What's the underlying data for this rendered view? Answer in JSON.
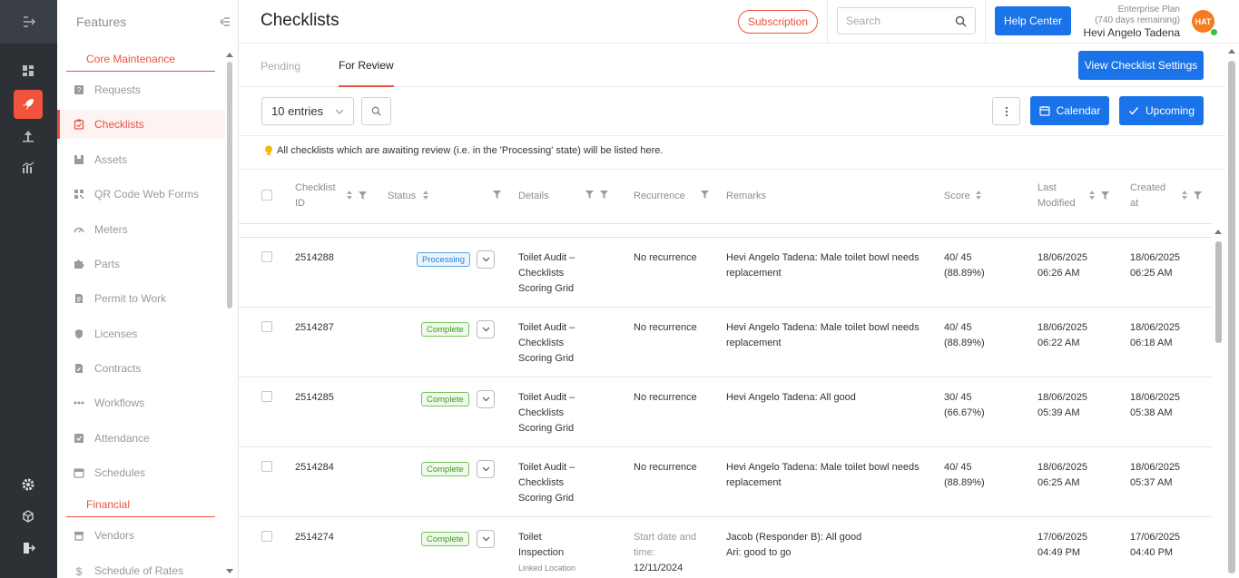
{
  "features": {
    "title": "Features",
    "sections": {
      "core": "Core Maintenance",
      "financial": "Financial"
    },
    "items": [
      {
        "label": "Requests",
        "icon": "question-square-icon"
      },
      {
        "label": "Checklists",
        "icon": "checklist-icon"
      },
      {
        "label": "Assets",
        "icon": "box-icon"
      },
      {
        "label": "QR Code Web Forms",
        "icon": "qr-code-icon"
      },
      {
        "label": "Meters",
        "icon": "gauge-icon"
      },
      {
        "label": "Parts",
        "icon": "puzzle-icon"
      },
      {
        "label": "Permit to Work",
        "icon": "document-icon"
      },
      {
        "label": "Licenses",
        "icon": "shield-icon"
      },
      {
        "label": "Contracts",
        "icon": "contract-icon"
      },
      {
        "label": "Workflows",
        "icon": "workflow-icon"
      },
      {
        "label": "Attendance",
        "icon": "attendance-icon"
      },
      {
        "label": "Schedules",
        "icon": "calendar-icon"
      }
    ],
    "financial_items": [
      {
        "label": "Vendors",
        "icon": "store-icon"
      },
      {
        "label": "Schedule of Rates",
        "icon": "dollar-icon"
      }
    ]
  },
  "header": {
    "title": "Checklists",
    "subscription": "Subscription",
    "search_placeholder": "Search",
    "help": "Help Center",
    "plan": "Enterprise Plan",
    "plan_remaining": "(740 days remaining)",
    "user_name": "Hevi Angelo Tadena",
    "avatar_initials": "HAT"
  },
  "tabs": {
    "pending": "Pending",
    "for_review": "For Review",
    "view_settings": "View Checklist Settings"
  },
  "toolbar": {
    "entries": "10 entries",
    "calendar": "Calendar",
    "upcoming": "Upcoming"
  },
  "info_text": "All checklists which are awaiting review (i.e. in the 'Processing' state) will be listed here.",
  "columns": {
    "checklist_id_1": "Checklist",
    "checklist_id_2": "ID",
    "status": "Status",
    "details": "Details",
    "recurrence": "Recurrence",
    "remarks": "Remarks",
    "score": "Score",
    "last_modified_1": "Last",
    "last_modified_2": "Modified",
    "created_at_1": "Created",
    "created_at_2": "at"
  },
  "rows": [
    {
      "id": "2514288",
      "status": "Processing",
      "details": [
        "Toilet Audit –",
        "Checklists",
        "Scoring Grid"
      ],
      "recurrence": "No recurrence",
      "remarks": [
        "Hevi Angelo Tadena: Male toilet bowl needs",
        "replacement"
      ],
      "score": [
        "40/ 45",
        "(88.89%)"
      ],
      "modified": [
        "18/06/2025",
        "06:26 AM"
      ],
      "created": [
        "18/06/2025",
        "06:25 AM"
      ]
    },
    {
      "id": "2514287",
      "status": "Complete",
      "details": [
        "Toilet Audit –",
        "Checklists",
        "Scoring Grid"
      ],
      "recurrence": "No recurrence",
      "remarks": [
        "Hevi Angelo Tadena: Male toilet bowl needs",
        "replacement"
      ],
      "score": [
        "40/ 45",
        "(88.89%)"
      ],
      "modified": [
        "18/06/2025",
        "06:22 AM"
      ],
      "created": [
        "18/06/2025",
        "06:18 AM"
      ]
    },
    {
      "id": "2514285",
      "status": "Complete",
      "details": [
        "Toilet Audit –",
        "Checklists",
        "Scoring Grid"
      ],
      "recurrence": "No recurrence",
      "remarks": [
        "Hevi Angelo Tadena: All good",
        ""
      ],
      "score": [
        "30/ 45",
        "(66.67%)"
      ],
      "modified": [
        "18/06/2025",
        "05:39 AM"
      ],
      "created": [
        "18/06/2025",
        "05:38 AM"
      ]
    },
    {
      "id": "2514284",
      "status": "Complete",
      "details": [
        "Toilet Audit –",
        "Checklists",
        "Scoring Grid"
      ],
      "recurrence": "No recurrence",
      "remarks": [
        "Hevi Angelo Tadena: Male toilet bowl needs",
        "replacement"
      ],
      "score": [
        "40/ 45",
        "(88.89%)"
      ],
      "modified": [
        "18/06/2025",
        "06:25 AM"
      ],
      "created": [
        "18/06/2025",
        "05:37 AM"
      ]
    },
    {
      "id": "2514274",
      "status": "Complete",
      "details": [
        "Toilet",
        "Inspection",
        "Linked Location"
      ],
      "recurrence_label": [
        "Start date and",
        "time:"
      ],
      "recurrence_value": "12/11/2024",
      "remarks": [
        "Jacob (Responder B): All good",
        "Ari: good to go"
      ],
      "modified": [
        "17/06/2025",
        "04:49 PM"
      ],
      "created": [
        "17/06/2025",
        "04:40 PM"
      ]
    }
  ],
  "colors": {
    "accent": "#e8543f",
    "primary": "#1a73e8",
    "rail": "#2d3136"
  }
}
